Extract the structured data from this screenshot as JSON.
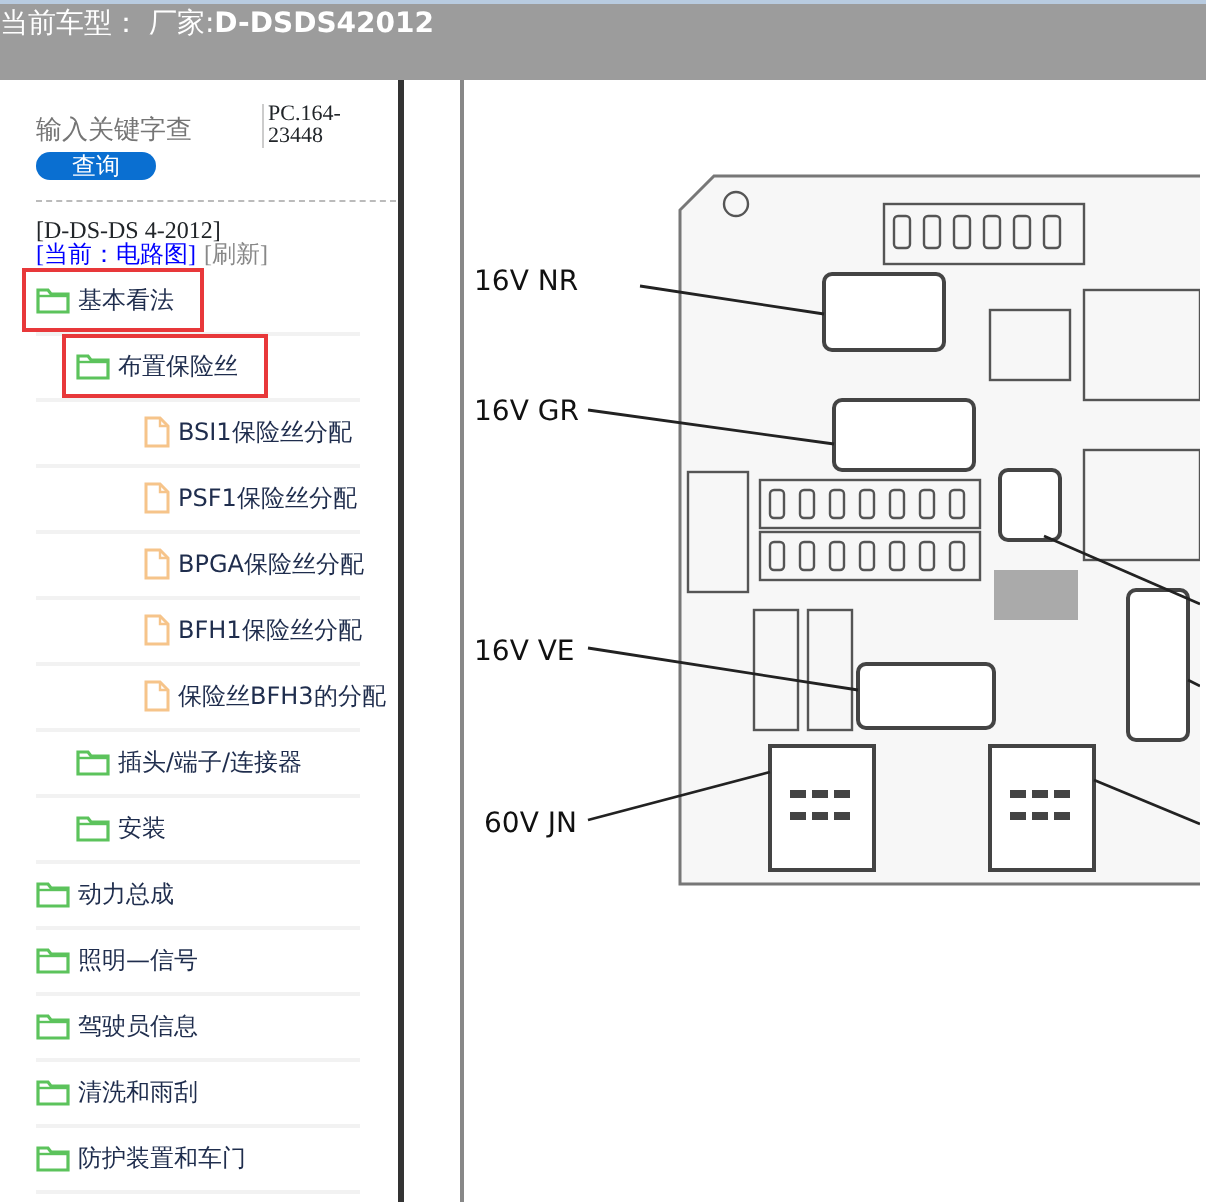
{
  "header": {
    "title": "当前车型： 厂家:**D-DSDS42012**"
  },
  "search": {
    "placeholder": "输入关键字查",
    "button": "查询",
    "code": "PC.164-23448"
  },
  "manual": {
    "title": "[D-DS-DS 4-2012]",
    "current_link": "[当前：电路图]",
    "refresh": "[刷新]"
  },
  "tree": [
    {
      "label": "基本看法",
      "kind": "folder",
      "highlighted": true,
      "children": [
        {
          "label": "布置保险丝",
          "kind": "folder",
          "highlighted": true,
          "children": [
            {
              "label": "BSI1保险丝分配",
              "kind": "file",
              "highlighted": false
            },
            {
              "label": "PSF1保险丝分配",
              "kind": "file",
              "highlighted": false
            },
            {
              "label": "BPGA保险丝分配",
              "kind": "file",
              "highlighted": false
            },
            {
              "label": "BFH1保险丝分配",
              "kind": "file",
              "highlighted": false
            },
            {
              "label": "保险丝BFH3的分配",
              "kind": "file",
              "highlighted": false
            }
          ]
        },
        {
          "label": "插头/端子/连接器",
          "kind": "folder",
          "highlighted": false
        },
        {
          "label": "安装",
          "kind": "folder",
          "highlighted": false
        }
      ]
    },
    {
      "label": "动力总成",
      "kind": "folder",
      "highlighted": false
    },
    {
      "label": "照明—信号",
      "kind": "folder",
      "highlighted": false
    },
    {
      "label": "驾驶员信息",
      "kind": "folder",
      "highlighted": false
    },
    {
      "label": "清洗和雨刮",
      "kind": "folder",
      "highlighted": false
    },
    {
      "label": "防护装置和车门",
      "kind": "folder",
      "highlighted": false
    }
  ],
  "diagram": {
    "labels": [
      "16V NR",
      "16V GR",
      "16V VE",
      "60V JN"
    ]
  }
}
